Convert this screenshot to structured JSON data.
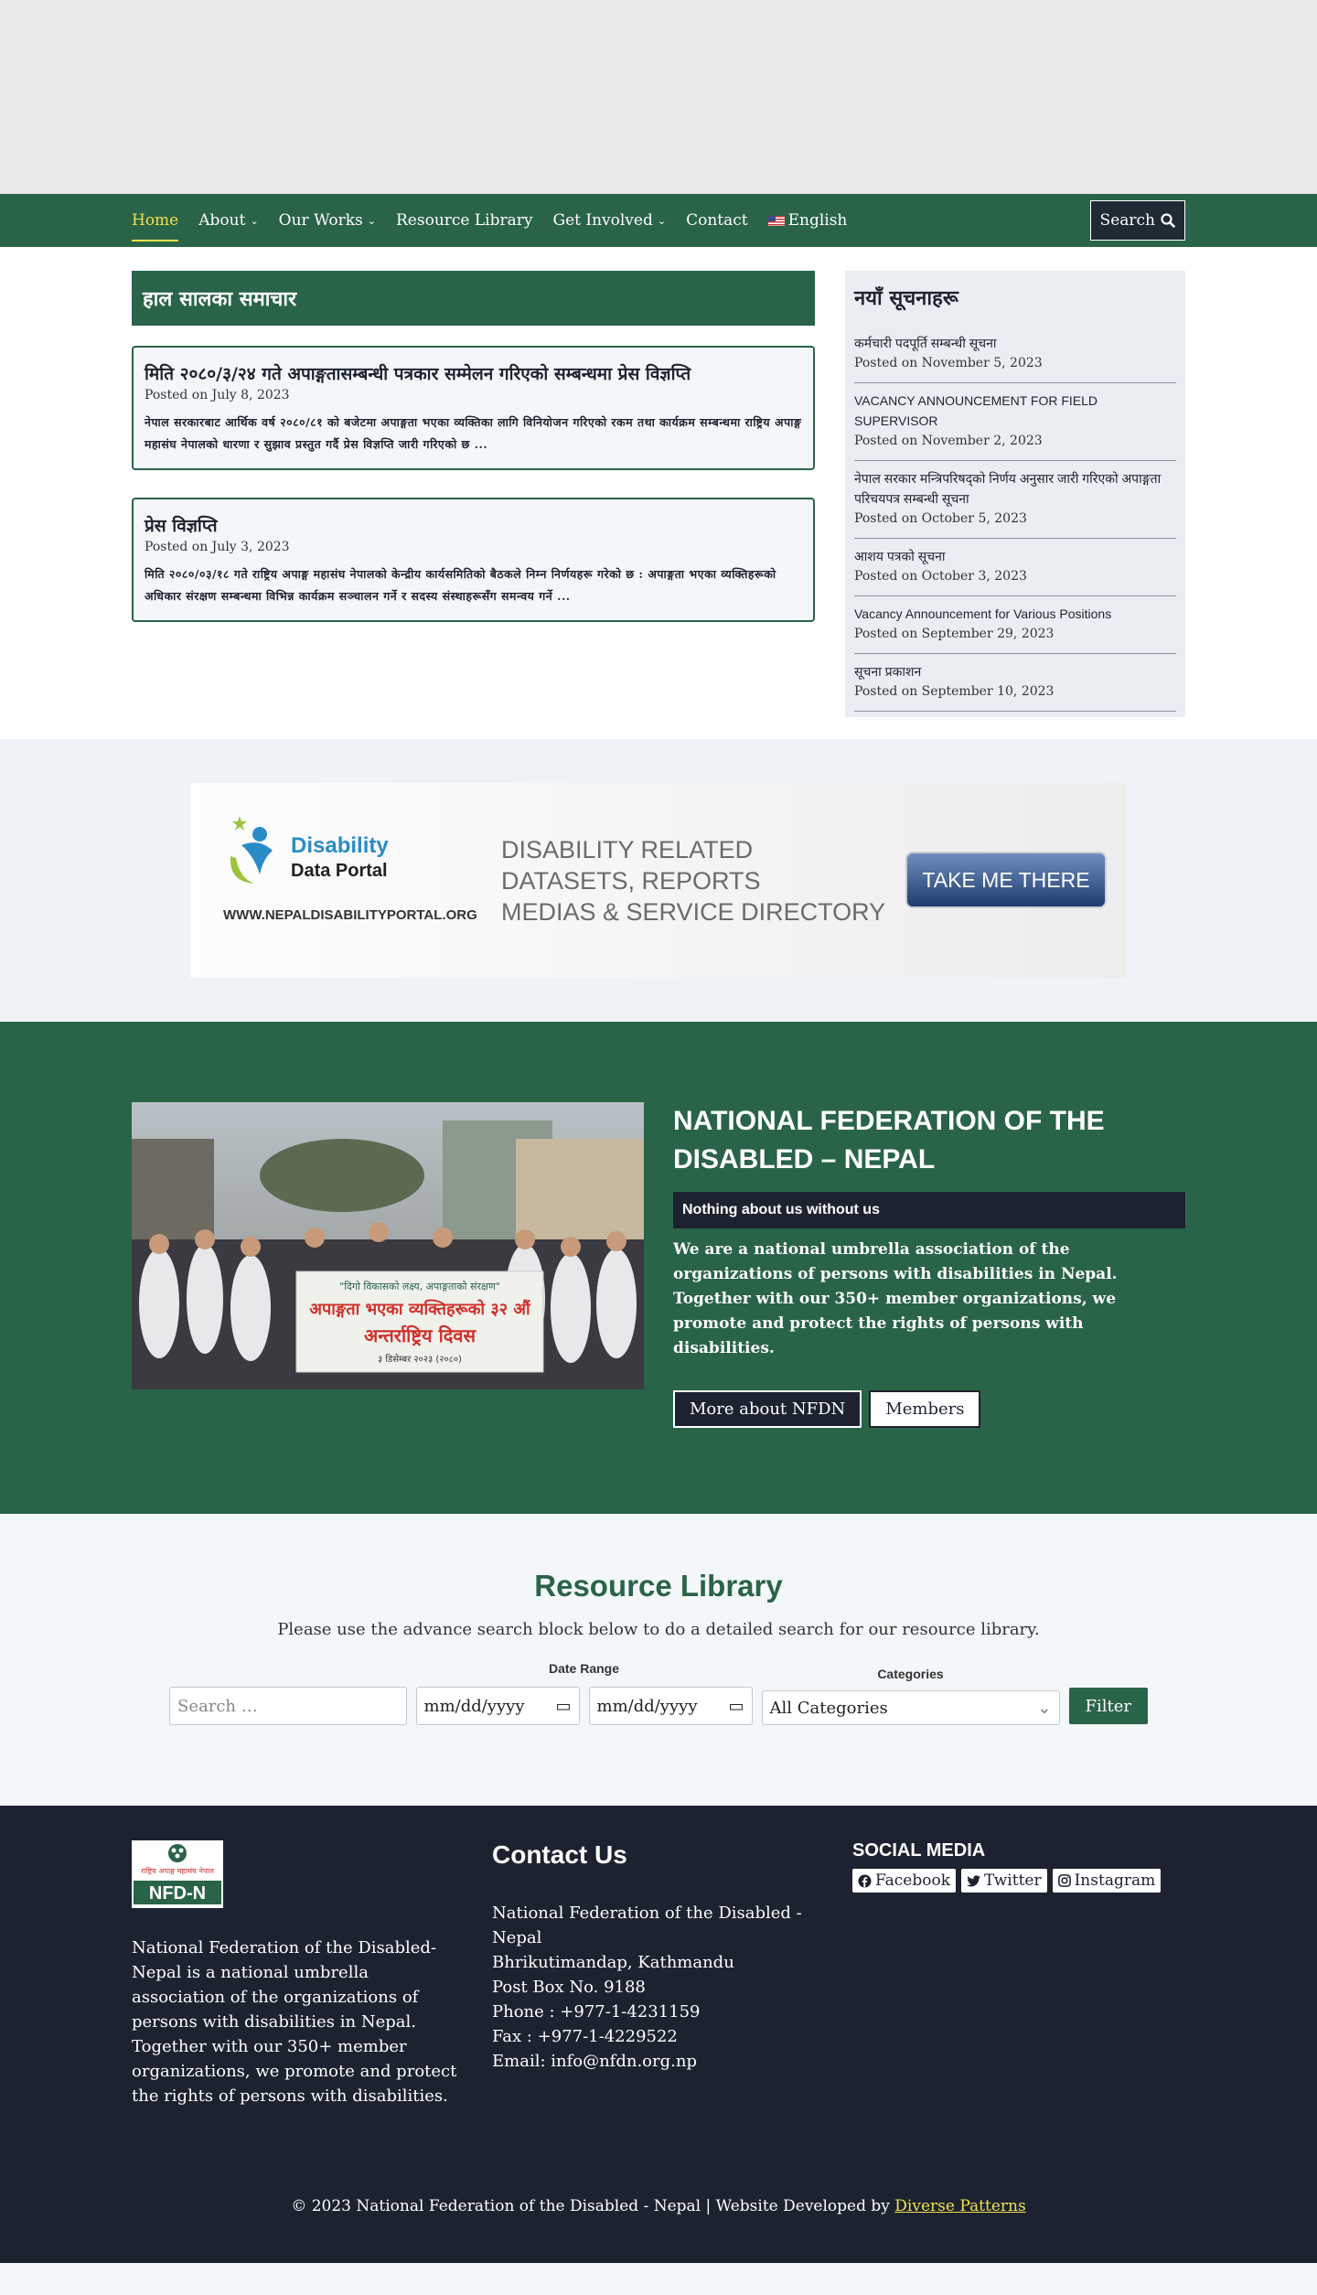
{
  "nav": {
    "items": [
      {
        "label": "Home",
        "caret": false,
        "active": true
      },
      {
        "label": "About",
        "caret": true
      },
      {
        "label": "Our Works",
        "caret": true
      },
      {
        "label": "Resource Library",
        "caret": false
      },
      {
        "label": "Get Involved",
        "caret": true
      },
      {
        "label": "Contact",
        "caret": false
      }
    ],
    "language": "English",
    "search_label": "Search"
  },
  "news": {
    "header": "हाल सालका समाचार",
    "posts": [
      {
        "title": "मिति २०८०/३/२४ गते अपाङ्गतासम्बन्धी पत्रकार सम्मेलन गरिएको सम्बन्धमा प्रेस विज्ञप्ति",
        "date": "Posted on July 8, 2023",
        "excerpt": "नेपाल सरकारबाट आर्थिक वर्ष २०८०/८१ को बजेटमा अपाङ्गता भएका व्यक्तिका लागि विनियोजन गरिएको रकम तथा कार्यक्रम सम्बन्धमा राष्ट्रिय अपाङ्ग महासंघ नेपालको धारणा र सुझाव प्रस्तुत गर्दै प्रेस विज्ञप्ति जारी गरिएको छ ..."
      },
      {
        "title": "प्रेस विज्ञप्ति",
        "date": "Posted on July 3, 2023",
        "excerpt": "मिति २०८०/०३/१८ गते राष्ट्रिय अपाङ्ग महासंघ नेपालको केन्द्रीय कार्यसमितिको बैठकले निम्न निर्णयहरू गरेको छ : अपाङ्गता भएका व्यक्तिहरूको अधिकार संरक्षण सम्बन्धमा विभिन्न कार्यक्रम सञ्चालन गर्ने र सदस्य संस्थाहरूसँग समन्वय गर्ने ..."
      }
    ]
  },
  "sidebar": {
    "title": "नयाँ सूचनाहरू",
    "items": [
      {
        "title": "कर्मचारी पदपूर्ति सम्बन्धी सूचना",
        "date": "Posted on November 5, 2023"
      },
      {
        "title": "VACANCY ANNOUNCEMENT FOR FIELD SUPERVISOR",
        "date": "Posted on November 2, 2023"
      },
      {
        "title": "नेपाल सरकार मन्त्रिपरिषद्को निर्णय अनुसार जारी गरिएको अपाङ्गता परिचयपत्र सम्बन्धी सूचना",
        "date": "Posted on October 5, 2023"
      },
      {
        "title": "आशय पत्रको सूचना",
        "date": "Posted on October 3, 2023"
      },
      {
        "title": "Vacancy Announcement for Various Positions",
        "date": "Posted on September 29, 2023"
      },
      {
        "title": "सूचना प्रकाशन",
        "date": "Posted on September 10, 2023"
      }
    ]
  },
  "banner": {
    "logo_line1": "Disability",
    "logo_line2": "Data Portal",
    "url": "WWW.NEPALDISABILITYPORTAL.ORG",
    "text_line1": "DISABILITY RELATED",
    "text_line2": "DATASETS, REPORTS",
    "text_line3": "MEDIAS & SERVICE DIRECTORY",
    "button": "TAKE ME THERE"
  },
  "about": {
    "photo_banner_line1": "\"दिगो विकासको लक्ष्य, अपाङ्गताको संरक्षण\"",
    "photo_banner_line2": "अपाङ्गता भएका व्यक्तिहरूको ३२ औं",
    "photo_banner_line3": "अन्तर्राष्ट्रिय दिवस",
    "photo_banner_line4": "३ डिसेम्बर २०२३ (२०८०)",
    "title": "NATIONAL FEDERATION OF THE DISABLED – NEPAL",
    "tagline": "Nothing about us without us",
    "text": "We are a national umbrella association of the organizations of persons with disabilities in Nepal. Together with our 350+ member organizations, we promote and protect the rights of persons with disabilities.",
    "btn_more": "More about NFDN",
    "btn_members": "Members"
  },
  "resource": {
    "title": "Resource Library",
    "description": "Please use the advance search block below to do a detailed search for our resource library.",
    "search_placeholder": "Search …",
    "date_range_label": "Date Range",
    "date_from": "mm/dd/yyyy",
    "date_to": "mm/dd/yyyy",
    "categories_label": "Categories",
    "categories_value": "All Categories",
    "filter_label": "Filter"
  },
  "footer": {
    "logo_top": "राष्ट्रिय अपाङ्ग महासंघ नेपाल",
    "logo_text": "NFD-N",
    "about": "National Federation of the Disabled-Nepal is a national umbrella association of the organizations of persons with disabilities in Nepal. Together with our 350+ member organizations, we promote and protect the rights of persons with disabilities.",
    "contact_title": "Contact Us",
    "contact_lines": [
      "National Federation of the Disabled - Nepal",
      "Bhrikutimandap, Kathmandu",
      "Post Box No. 9188",
      "Phone : +977-1-4231159",
      "Fax : +977-1-4229522",
      "Email: info@nfdn.org.np"
    ],
    "social_title": "SOCIAL MEDIA",
    "social": [
      "Facebook",
      "Twitter",
      "Instagram"
    ],
    "copyright": "© 2023 National Federation of the Disabled - Nepal | Website Developed by",
    "developer": "Diverse Patterns"
  },
  "colors": {
    "brand_green": "#2a6448",
    "dark_navy": "#1c2230",
    "accent_yellow": "#f4e04d"
  }
}
